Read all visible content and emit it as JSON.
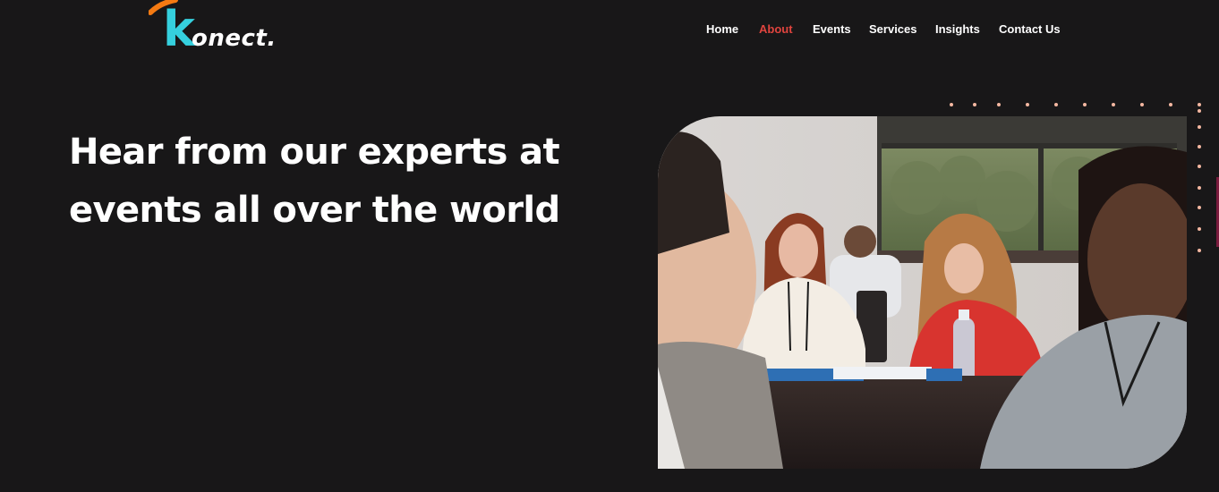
{
  "brand": {
    "logo_k": "k",
    "logo_rest": "onect.",
    "colors": {
      "k": "#35d0de",
      "swoosh": "#f47a12",
      "text": "#ffffff"
    }
  },
  "nav": {
    "items": [
      {
        "label": "Home",
        "active": false
      },
      {
        "label": "About",
        "active": true
      },
      {
        "label": "Events",
        "active": false
      },
      {
        "label": "Services",
        "active": false
      },
      {
        "label": "Insights",
        "active": false
      },
      {
        "label": "Contact Us",
        "active": false
      }
    ],
    "active_color": "#e0443e"
  },
  "hero": {
    "title_line1": "Hear from our experts at",
    "title_line2": "events all over the world",
    "image_alt": "Conference attendees seated at tables"
  },
  "theme": {
    "background": "#181718",
    "dot_color": "#f4b7a1",
    "dot_color_alt": "#ffffff",
    "accent_bar": "#7a1b3e"
  }
}
